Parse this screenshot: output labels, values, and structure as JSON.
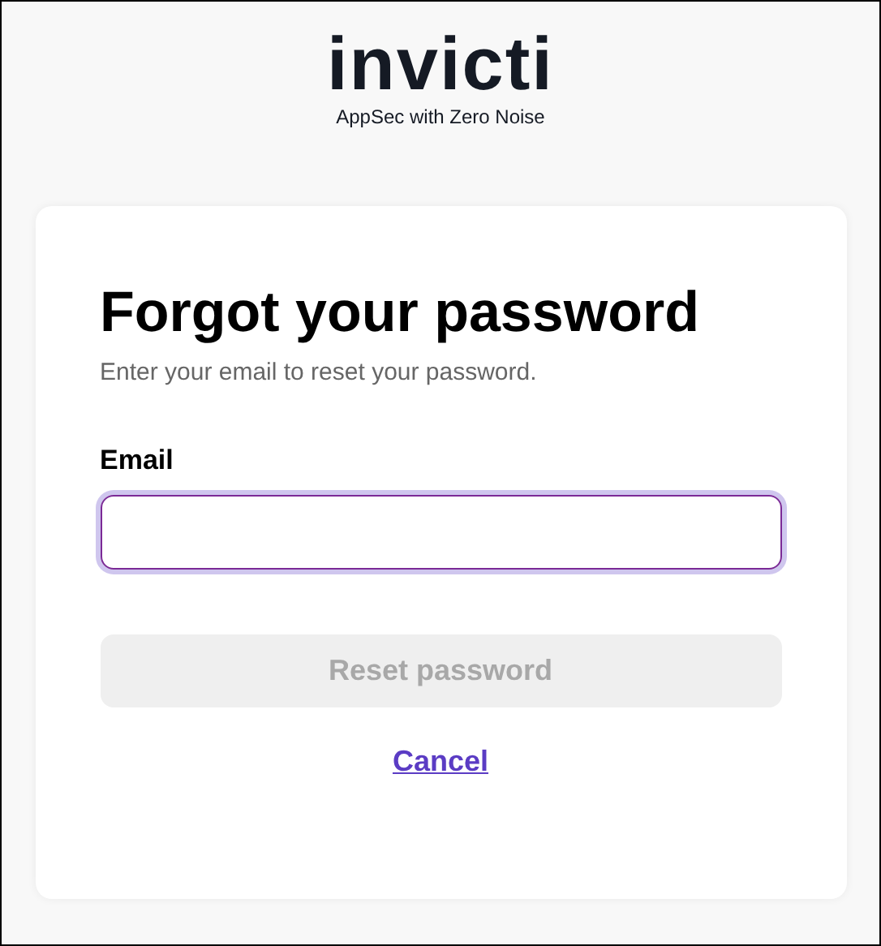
{
  "logo": {
    "wordmark": "invicti",
    "tagline": "AppSec with Zero Noise"
  },
  "form": {
    "title": "Forgot your password",
    "subtitle": "Enter your email to reset your password.",
    "email": {
      "label": "Email",
      "focused": true
    },
    "submit": {
      "label": "Reset password",
      "disabled": true
    },
    "cancel": {
      "label": "Cancel"
    }
  }
}
